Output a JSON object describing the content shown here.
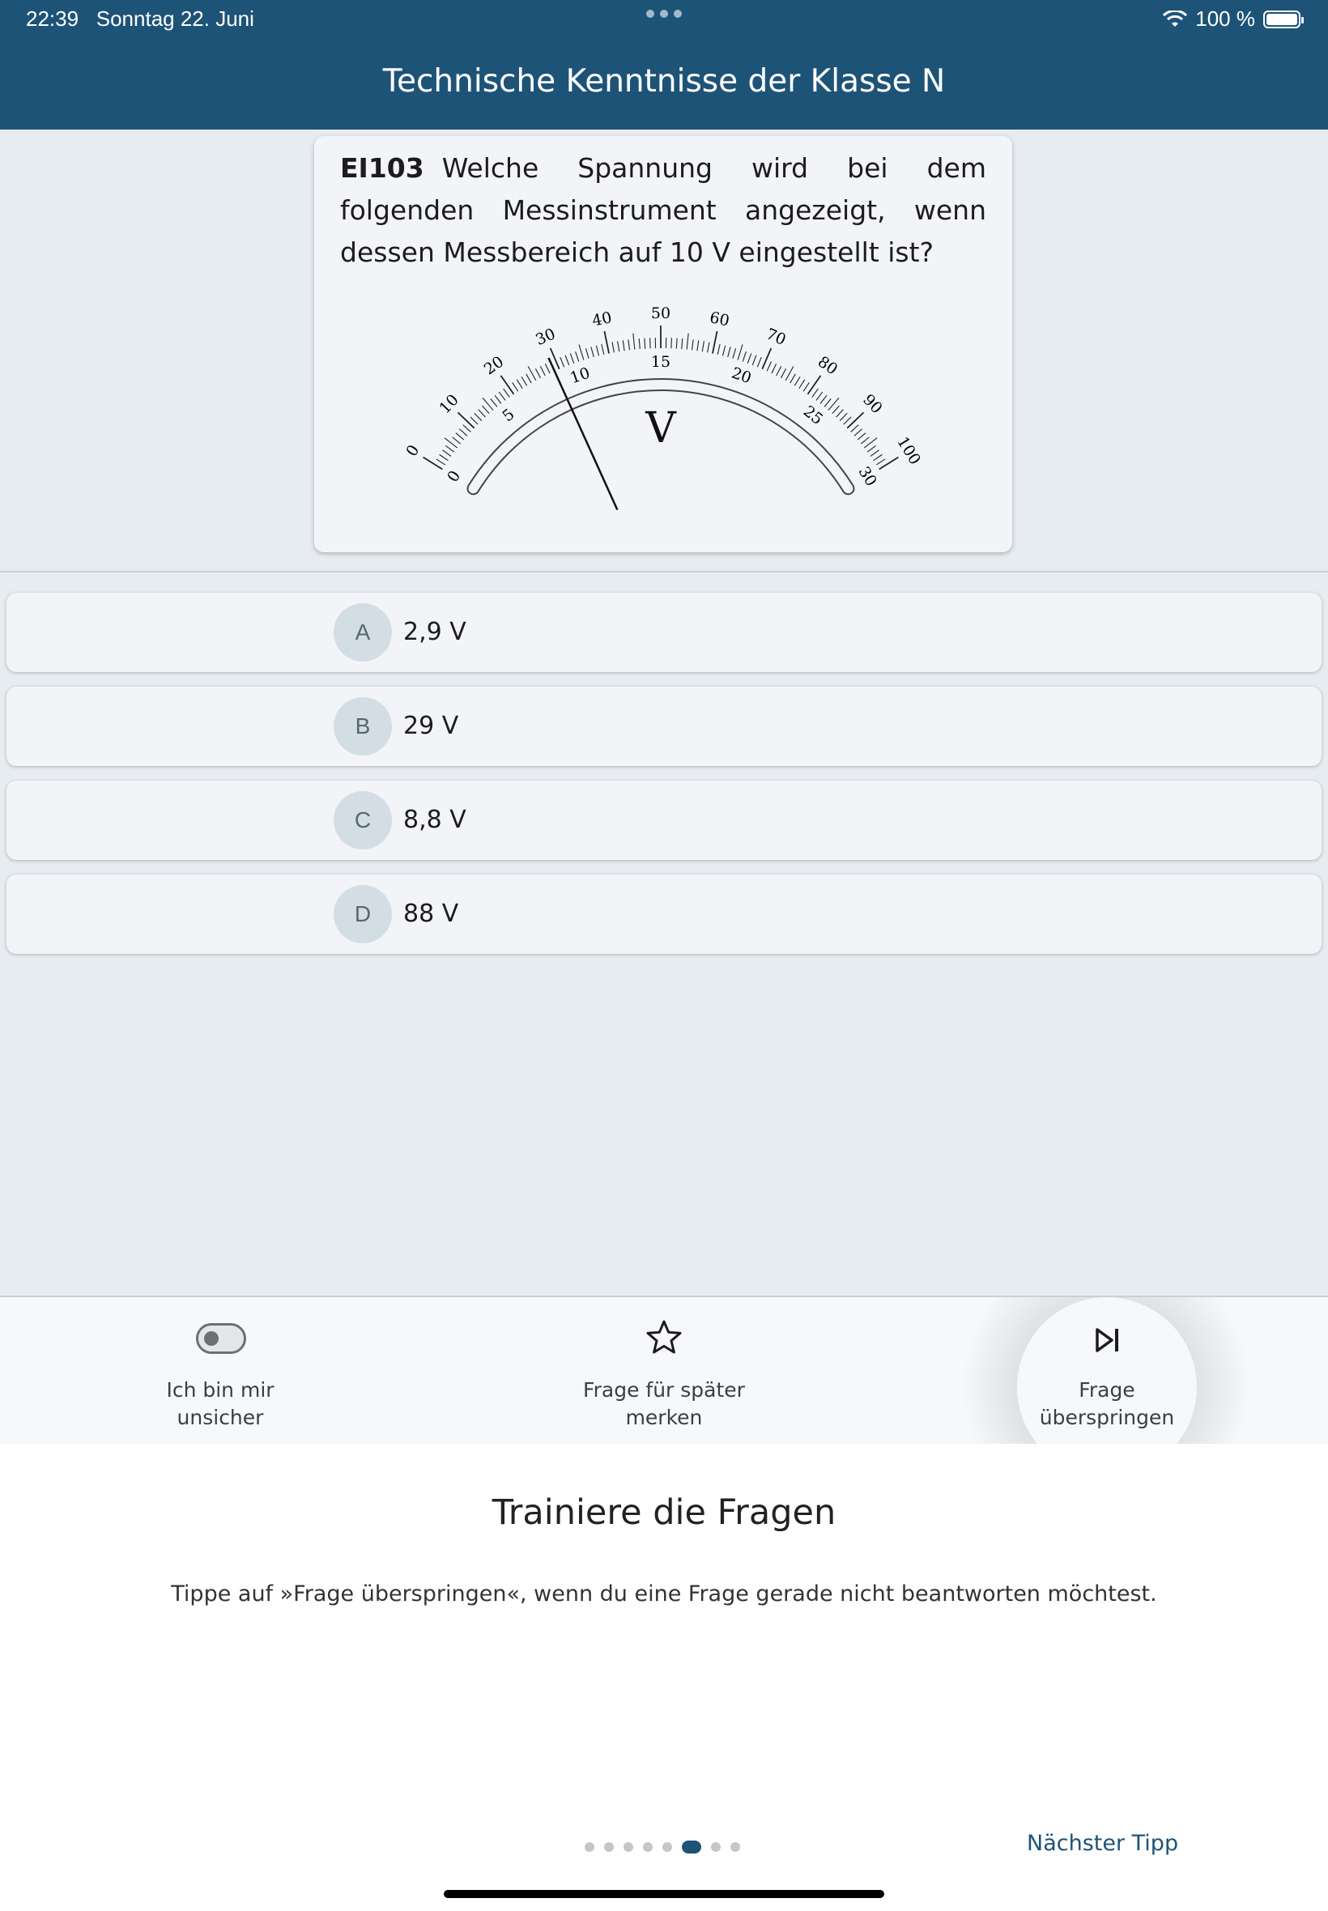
{
  "status_bar": {
    "time": "22:39",
    "date": "Sonntag 22. Juni",
    "battery": "100 %"
  },
  "header": {
    "title": "Technische Kenntnisse der Klasse N"
  },
  "question": {
    "id": "EI103",
    "text": "Welche Spannung wird bei dem folgenden Messinstrument angezeigt, wenn dessen Messbereich auf 10 V eingestellt ist?",
    "meter": {
      "outer_scale_labels": [
        "0",
        "10",
        "20",
        "30",
        "40",
        "50",
        "60",
        "70",
        "80",
        "90",
        "100"
      ],
      "inner_scale_labels": [
        "0",
        "5",
        "10",
        "15",
        "20",
        "25",
        "30"
      ],
      "unit": "V",
      "needle_value_outer_scale": 29
    }
  },
  "answers": [
    {
      "letter": "A",
      "text": "2,9 V"
    },
    {
      "letter": "B",
      "text": "29 V"
    },
    {
      "letter": "C",
      "text": "8,8 V"
    },
    {
      "letter": "D",
      "text": "88 V"
    }
  ],
  "toolbar": {
    "unsure_label_1": "Ich bin mir",
    "unsure_label_2": "unsicher",
    "bookmark_label_1": "Frage für später",
    "bookmark_label_2": "merken",
    "skip_label_1": "Frage",
    "skip_label_2": "überspringen",
    "unsure_toggle_on": false
  },
  "tip_sheet": {
    "title": "Trainiere die Fragen",
    "text": "Tippe auf »Frage überspringen«, wenn du eine Frage gerade nicht beantworten möchtest.",
    "page_count": 8,
    "active_page": 5,
    "next_label": "Nächster Tipp"
  },
  "colors": {
    "accent": "#1e5378",
    "background": "#e7ecf0"
  }
}
